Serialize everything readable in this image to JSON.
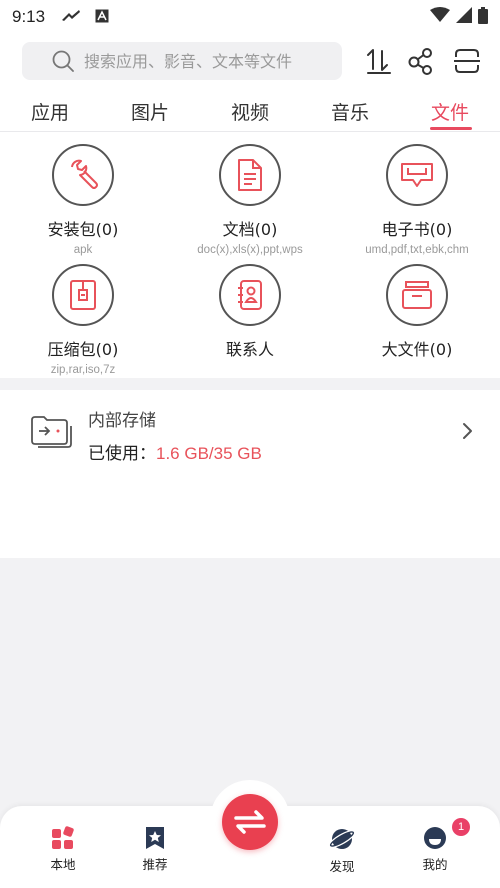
{
  "status_bar": {
    "time": "9:13",
    "icons_left": [
      "navigation-icon",
      "font-icon"
    ],
    "icons_right": [
      "wifi-icon",
      "signal-icon",
      "battery-icon"
    ]
  },
  "search": {
    "placeholder": "搜索应用、影音、文本等文件",
    "icons": [
      "sort-icon",
      "share-icon",
      "scan-icon"
    ]
  },
  "tabs": [
    {
      "label": "应用",
      "active": false
    },
    {
      "label": "图片",
      "active": false
    },
    {
      "label": "视频",
      "active": false
    },
    {
      "label": "音乐",
      "active": false
    },
    {
      "label": "文件",
      "active": true
    }
  ],
  "categories": [
    {
      "label": "安装包(0)",
      "sub": "apk",
      "icon": "wrench-icon"
    },
    {
      "label": "文档(0)",
      "sub": "doc(x),xls(x),ppt,wps",
      "icon": "document-icon"
    },
    {
      "label": "电子书(0)",
      "sub": "umd,pdf,txt,ebk,chm",
      "icon": "ebook-icon"
    },
    {
      "label": "压缩包(0)",
      "sub": "zip,rar,iso,7z",
      "icon": "archive-icon"
    },
    {
      "label": "联系人",
      "sub": "",
      "icon": "contact-icon"
    },
    {
      "label": "大文件(0)",
      "sub": "",
      "icon": "box-icon"
    }
  ],
  "storage": {
    "title": "内部存储",
    "used_label": "已使用：",
    "used_value": "1.6 GB/35 GB"
  },
  "bottom_nav": [
    {
      "label": "本地",
      "icon": "local-icon"
    },
    {
      "label": "推荐",
      "icon": "star-bookmark-icon"
    },
    {
      "label": "发现",
      "icon": "planet-icon"
    },
    {
      "label": "我的",
      "icon": "profile-icon"
    }
  ],
  "badge_count": "1",
  "colors": {
    "accent": "#e84a5f",
    "center_button": "#e94050",
    "used_value": "#e8525a"
  }
}
